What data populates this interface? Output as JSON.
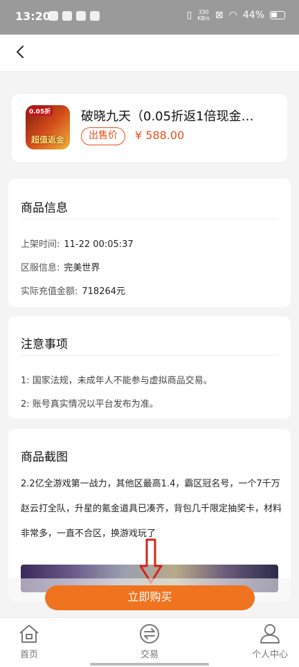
{
  "status_bar": {
    "time": "13:20",
    "speed_value": "330",
    "speed_unit": "KB/s",
    "battery": "44%"
  },
  "product": {
    "title": "破晓九天（0.05折返1倍现金…",
    "icon_tag": "0.05折",
    "icon_text": "超值返金",
    "sale_label": "出售价",
    "price": "¥ 588.00"
  },
  "info": {
    "title": "商品信息",
    "rows": [
      {
        "label": "上架时间:",
        "value": "11-22 00:05:37"
      },
      {
        "label": "区服信息:",
        "value": "完美世界"
      },
      {
        "label": "实际充值金额:",
        "value": "718264元"
      }
    ]
  },
  "notes": {
    "title": "注意事项",
    "items": [
      "1: 国家法规，未成年人不能参与虚拟商品交易。",
      "2: 账号真实情况以平台发布为准。"
    ]
  },
  "screenshots": {
    "title": "商品截图",
    "description": "2.2亿全游戏第一战力，其他区最高1.4，霸区冠名号，一个7千万赵云打全队，升星的氪金道具已凑齐，背包几千限定抽奖卡，材料非常多，一直不合区，换游戏玩了"
  },
  "buy_button": "立即购买",
  "tabs": [
    {
      "label": "首页",
      "icon": "home-icon"
    },
    {
      "label": "交易",
      "icon": "exchange-icon"
    },
    {
      "label": "个人中心",
      "icon": "user-icon"
    }
  ],
  "colors": {
    "accent": "#f0731f",
    "price": "#e8511a",
    "arrow": "#d8231a"
  }
}
